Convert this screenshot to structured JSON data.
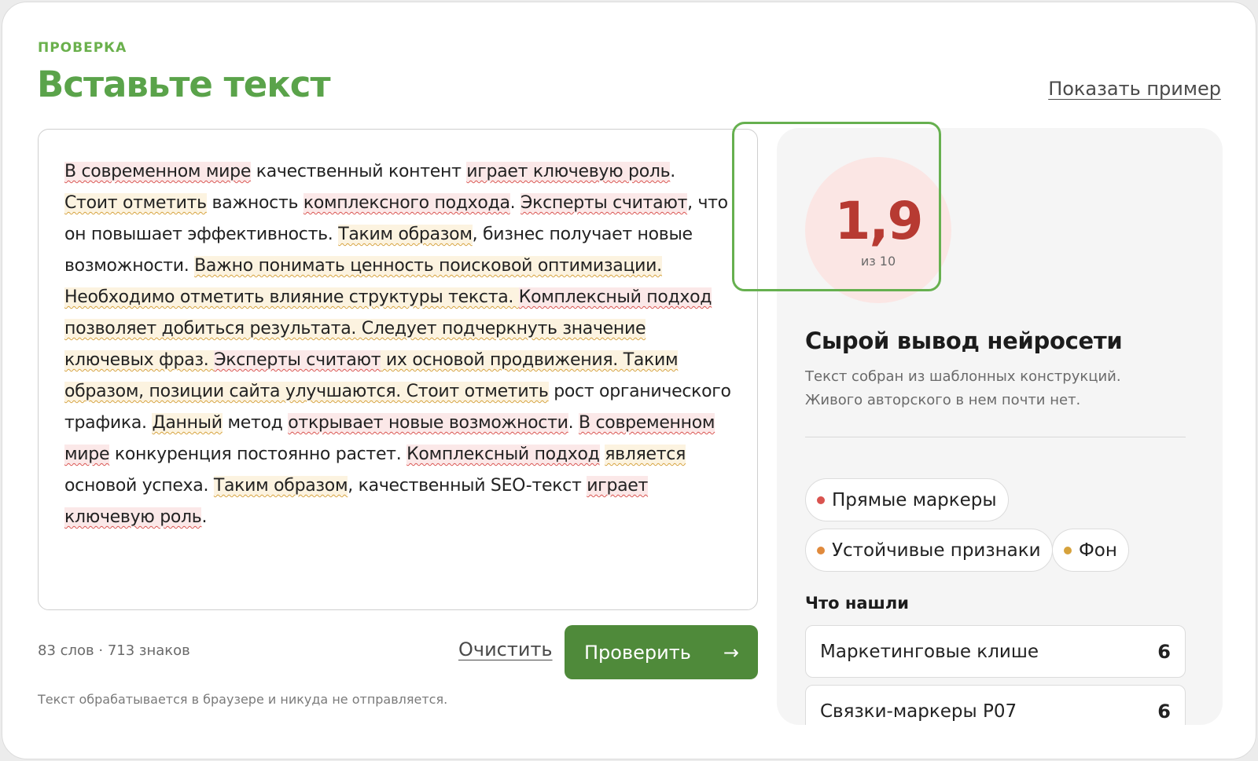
{
  "header": {
    "eyebrow": "ПРОВЕРКА",
    "title": "Вставьте текст",
    "show_example": "Показать пример"
  },
  "editor": {
    "segments": [
      {
        "text": "В современном мире",
        "hl": "red"
      },
      {
        "text": " качественный контент ",
        "hl": ""
      },
      {
        "text": "играет ключевую роль",
        "hl": "red"
      },
      {
        "text": ". ",
        "hl": ""
      },
      {
        "text": "Стоит отметить",
        "hl": "yel"
      },
      {
        "text": " важность ",
        "hl": ""
      },
      {
        "text": "комплексного подхода",
        "hl": "red"
      },
      {
        "text": ". ",
        "hl": ""
      },
      {
        "text": "Эксперты считают",
        "hl": "red"
      },
      {
        "text": ", что он повышает эффективность. ",
        "hl": ""
      },
      {
        "text": "Таким образом",
        "hl": "yel"
      },
      {
        "text": ", бизнес получает новые возможности. ",
        "hl": ""
      },
      {
        "text": "Важно понимать ценность поисковой оптимизации. Необходимо отметить влияние структуры текста. ",
        "hl": "yel"
      },
      {
        "text": "Комплексный подход",
        "hl": "red"
      },
      {
        "text": " позволяет добиться результата. Следует подчеркнуть значение ключевых фраз. ",
        "hl": "yel"
      },
      {
        "text": "Эксперты считают",
        "hl": "red"
      },
      {
        "text": " их основой продвижения. Таким образом, позиции сайта улучшаются. ",
        "hl": "yel"
      },
      {
        "text": "Стоит отметить",
        "hl": "yel"
      },
      {
        "text": " рост органического трафика. ",
        "hl": ""
      },
      {
        "text": "Данный",
        "hl": "yel"
      },
      {
        "text": " метод ",
        "hl": ""
      },
      {
        "text": "открывает новые возможности",
        "hl": "red"
      },
      {
        "text": ". ",
        "hl": ""
      },
      {
        "text": "В современном мире",
        "hl": "red"
      },
      {
        "text": " конкуренция постоянно растет. ",
        "hl": ""
      },
      {
        "text": "Комплексный подход",
        "hl": "red"
      },
      {
        "text": " ",
        "hl": ""
      },
      {
        "text": "является",
        "hl": "yel"
      },
      {
        "text": " основой успеха. ",
        "hl": ""
      },
      {
        "text": "Таким образом",
        "hl": "yel"
      },
      {
        "text": ", качественный SEO-текст ",
        "hl": ""
      },
      {
        "text": "играет ключевую роль",
        "hl": "red"
      },
      {
        "text": ".",
        "hl": ""
      }
    ],
    "counter": "83 слов · 713 знаков",
    "clear_label": "Очистить",
    "check_label": "Проверить",
    "check_arrow": "→",
    "privacy_note": "Текст обрабатывается в браузере и никуда не отправляется."
  },
  "result": {
    "score": "1,9",
    "score_max": "из 10",
    "verdict_title": "Сырой вывод нейросети",
    "verdict_desc": "Текст собран из шаблонных конструкций. Живого авторского в нем почти нет.",
    "chips": [
      {
        "label": "Прямые маркеры",
        "dot_color": "#d9534f"
      },
      {
        "label": "Устойчивые признаки",
        "dot_color": "#e08a3c"
      },
      {
        "label": "Фон",
        "dot_color": "#d6a23c"
      }
    ],
    "found_title": "Что нашли",
    "findings": [
      {
        "label": "Маркетинговые клише",
        "count": "6"
      },
      {
        "label": "Связки-маркеры P07",
        "count": "6"
      }
    ]
  },
  "colors": {
    "accent_green": "#5aa34a",
    "button_green": "#4f8a3a",
    "score_red": "#b73a32",
    "score_bg": "#fbe6e4"
  }
}
